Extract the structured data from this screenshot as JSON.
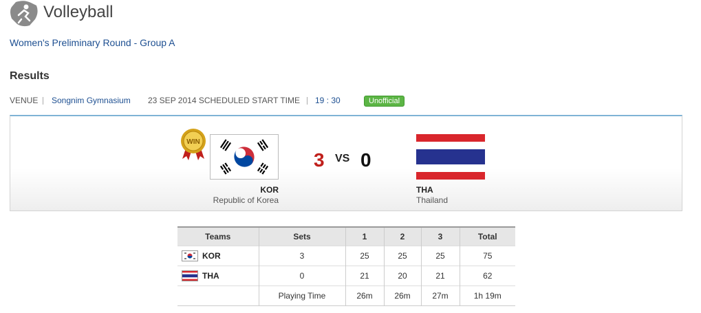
{
  "header": {
    "sport_title": "Volleyball",
    "event_title": "Women's Preliminary Round - Group A",
    "results_title": "Results"
  },
  "info": {
    "venue_label": "VENUE",
    "venue_name": "Songnim Gymnasium",
    "date_label": "23 SEP 2014 SCHEDULED START TIME",
    "start_time": "19 : 30",
    "status_badge": "Unofficial",
    "badge_color": "#5cb545"
  },
  "match": {
    "win_label": "WIN",
    "home": {
      "code": "KOR",
      "name": "Republic of Korea",
      "score": "3",
      "score_color": "#c0201c"
    },
    "vs_label": "VS",
    "away": {
      "code": "THA",
      "name": "Thailand",
      "score": "0"
    }
  },
  "table": {
    "headers": [
      "Teams",
      "Sets",
      "1",
      "2",
      "3",
      "Total"
    ],
    "rows": [
      {
        "team": "KOR",
        "sets": "3",
        "s1": "25",
        "s2": "25",
        "s3": "25",
        "total": "75"
      },
      {
        "team": "THA",
        "sets": "0",
        "s1": "21",
        "s2": "20",
        "s3": "21",
        "total": "62"
      }
    ],
    "playing_time": {
      "label": "Playing Time",
      "s1": "26m",
      "s2": "26m",
      "s3": "27m",
      "total": "1h 19m"
    }
  }
}
